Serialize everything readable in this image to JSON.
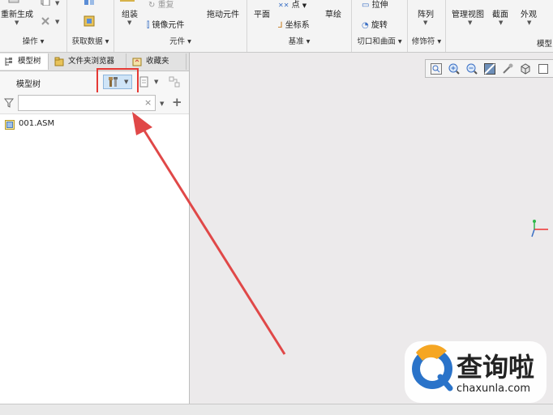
{
  "ribbon": {
    "groups": [
      {
        "label": "操作"
      },
      {
        "label": "获取数据"
      },
      {
        "label": "元件"
      },
      {
        "label": "基准"
      },
      {
        "label": "切口和曲面"
      },
      {
        "label": "修饰符"
      },
      {
        "label": "模型"
      }
    ],
    "regenerate": "重新生成",
    "assemble": "组装",
    "redo": "重复",
    "mirror_component": "镜像元件",
    "drag_component": "拖动元件",
    "plane": "平面",
    "point": "点",
    "coordinate_system": "坐标系",
    "sketch": "草绘",
    "extrude": "拉伸",
    "revolve": "旋转",
    "pattern": "阵列",
    "manage_views": "管理视图",
    "section": "截面",
    "appearance": "外观"
  },
  "tabs": [
    {
      "label": "模型树"
    },
    {
      "label": "文件夹浏览器"
    },
    {
      "label": "收藏夹"
    }
  ],
  "tree": {
    "title": "模型树",
    "search_value": "",
    "items": [
      {
        "label": "001.ASM"
      }
    ]
  },
  "colors": {
    "highlight_box": "#e53935",
    "arrow": "#e04848",
    "canvas_bg": "#eceaeb",
    "watermark_blue": "#2a73c9",
    "watermark_orange": "#f5a623"
  },
  "watermark": {
    "title": "查询啦",
    "domain": "chaxunla.com"
  },
  "icons": [
    "filter-icon",
    "settings-tools-icon",
    "show-icon",
    "add-icon",
    "clear-icon",
    "zoom-fit-icon",
    "zoom-in-icon",
    "zoom-out-icon",
    "repaint-icon",
    "spin-center-icon",
    "display-style-icon"
  ]
}
